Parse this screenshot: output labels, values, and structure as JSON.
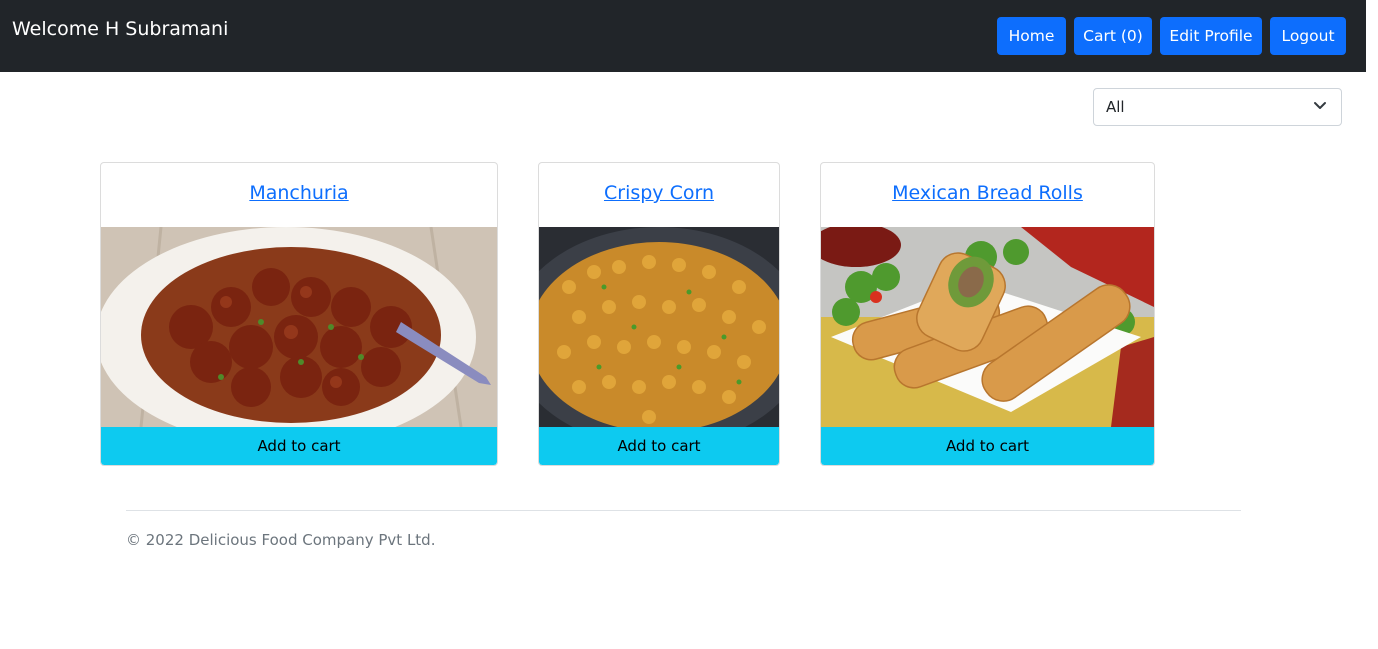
{
  "navbar": {
    "welcome": "Welcome H Subramani",
    "buttons": {
      "home": "Home",
      "cart": "Cart (0)",
      "edit_profile": "Edit Profile",
      "logout": "Logout"
    }
  },
  "filter": {
    "selected": "All"
  },
  "products": [
    {
      "name": "Manchuria",
      "action": "Add to cart"
    },
    {
      "name": "Crispy Corn",
      "action": "Add to cart"
    },
    {
      "name": "Mexican Bread Rolls",
      "action": "Add to cart"
    }
  ],
  "footer": {
    "copyright": "© 2022 Delicious Food Company Pvt Ltd."
  },
  "colors": {
    "navbar_bg": "#212529",
    "primary": "#0d6efd",
    "info": "#0dcaf0",
    "muted": "#6c757d"
  }
}
